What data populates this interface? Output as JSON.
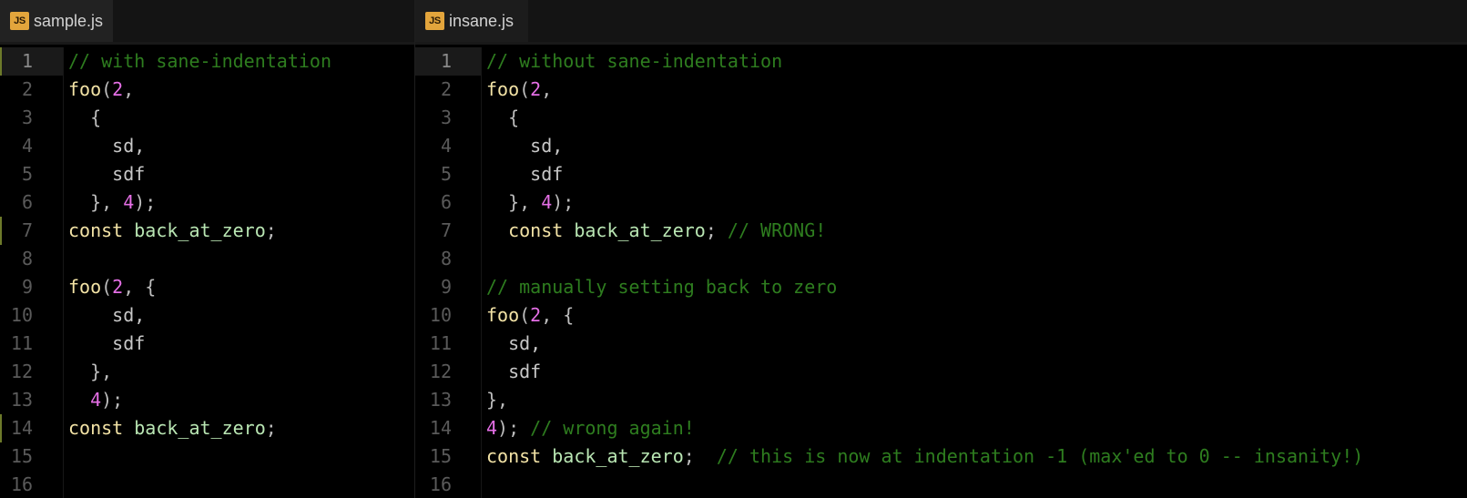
{
  "panes": {
    "left": {
      "tab_icon": "JS",
      "tab_title": "sample.js",
      "line_numbers": [
        "1",
        "2",
        "3",
        "4",
        "5",
        "6",
        "7",
        "8",
        "9",
        "10",
        "11",
        "12",
        "13",
        "14",
        "15",
        "16"
      ],
      "active_line": 0,
      "modified_lines": [
        0,
        6,
        13
      ],
      "lines": [
        [
          [
            "c",
            "// with sane-indentation"
          ]
        ],
        [
          [
            "fn",
            "foo"
          ],
          [
            "p",
            "("
          ],
          [
            "num",
            "2"
          ],
          [
            "p",
            ","
          ]
        ],
        [
          [
            "p",
            "  {"
          ]
        ],
        [
          [
            "v",
            "    sd,"
          ]
        ],
        [
          [
            "v",
            "    sdf"
          ]
        ],
        [
          [
            "p",
            "  }, "
          ],
          [
            "num",
            "4"
          ],
          [
            "p",
            ");"
          ]
        ],
        [
          [
            "kw",
            "const "
          ],
          [
            "id",
            "back_at_zero"
          ],
          [
            "p",
            ";"
          ]
        ],
        [],
        [
          [
            "fn",
            "foo"
          ],
          [
            "p",
            "("
          ],
          [
            "num",
            "2"
          ],
          [
            "p",
            ", {"
          ]
        ],
        [
          [
            "v",
            "    sd,"
          ]
        ],
        [
          [
            "v",
            "    sdf"
          ]
        ],
        [
          [
            "p",
            "  },"
          ]
        ],
        [
          [
            "p",
            "  "
          ],
          [
            "num",
            "4"
          ],
          [
            "p",
            ");"
          ]
        ],
        [
          [
            "kw",
            "const "
          ],
          [
            "id",
            "back_at_zero"
          ],
          [
            "p",
            ";"
          ]
        ],
        [],
        []
      ]
    },
    "right": {
      "tab_icon": "JS",
      "tab_title": "insane.js",
      "line_numbers": [
        "1",
        "2",
        "3",
        "4",
        "5",
        "6",
        "7",
        "8",
        "9",
        "10",
        "11",
        "12",
        "13",
        "14",
        "15",
        "16"
      ],
      "active_line": 0,
      "modified_lines": [],
      "lines": [
        [
          [
            "c",
            "// without sane-indentation"
          ]
        ],
        [
          [
            "fn",
            "foo"
          ],
          [
            "p",
            "("
          ],
          [
            "num",
            "2"
          ],
          [
            "p",
            ","
          ]
        ],
        [
          [
            "p",
            "  {"
          ]
        ],
        [
          [
            "v",
            "    sd,"
          ]
        ],
        [
          [
            "v",
            "    sdf"
          ]
        ],
        [
          [
            "p",
            "  }, "
          ],
          [
            "num",
            "4"
          ],
          [
            "p",
            ");"
          ]
        ],
        [
          [
            "kw",
            "  const "
          ],
          [
            "id",
            "back_at_zero"
          ],
          [
            "p",
            "; "
          ],
          [
            "c",
            "// WRONG!"
          ]
        ],
        [],
        [
          [
            "c",
            "// manually setting back to zero"
          ]
        ],
        [
          [
            "fn",
            "foo"
          ],
          [
            "p",
            "("
          ],
          [
            "num",
            "2"
          ],
          [
            "p",
            ", {"
          ]
        ],
        [
          [
            "v",
            "  sd,"
          ]
        ],
        [
          [
            "v",
            "  sdf"
          ]
        ],
        [
          [
            "p",
            "},"
          ]
        ],
        [
          [
            "num",
            "4"
          ],
          [
            "p",
            "); "
          ],
          [
            "c",
            "// wrong again!"
          ]
        ],
        [
          [
            "kw",
            "const "
          ],
          [
            "id",
            "back_at_zero"
          ],
          [
            "p",
            ";  "
          ],
          [
            "c",
            "// this is now at indentation -1 (max'ed to 0 -- insanity!)"
          ]
        ],
        []
      ]
    }
  },
  "colors": {
    "background": "#000000",
    "comment": "#2e7d1f",
    "function": "#f3e3a6",
    "number": "#e56fe6",
    "identifier": "#b9e6b3",
    "line_number": "#5a5a5a",
    "js_icon": "#e3a53c"
  }
}
